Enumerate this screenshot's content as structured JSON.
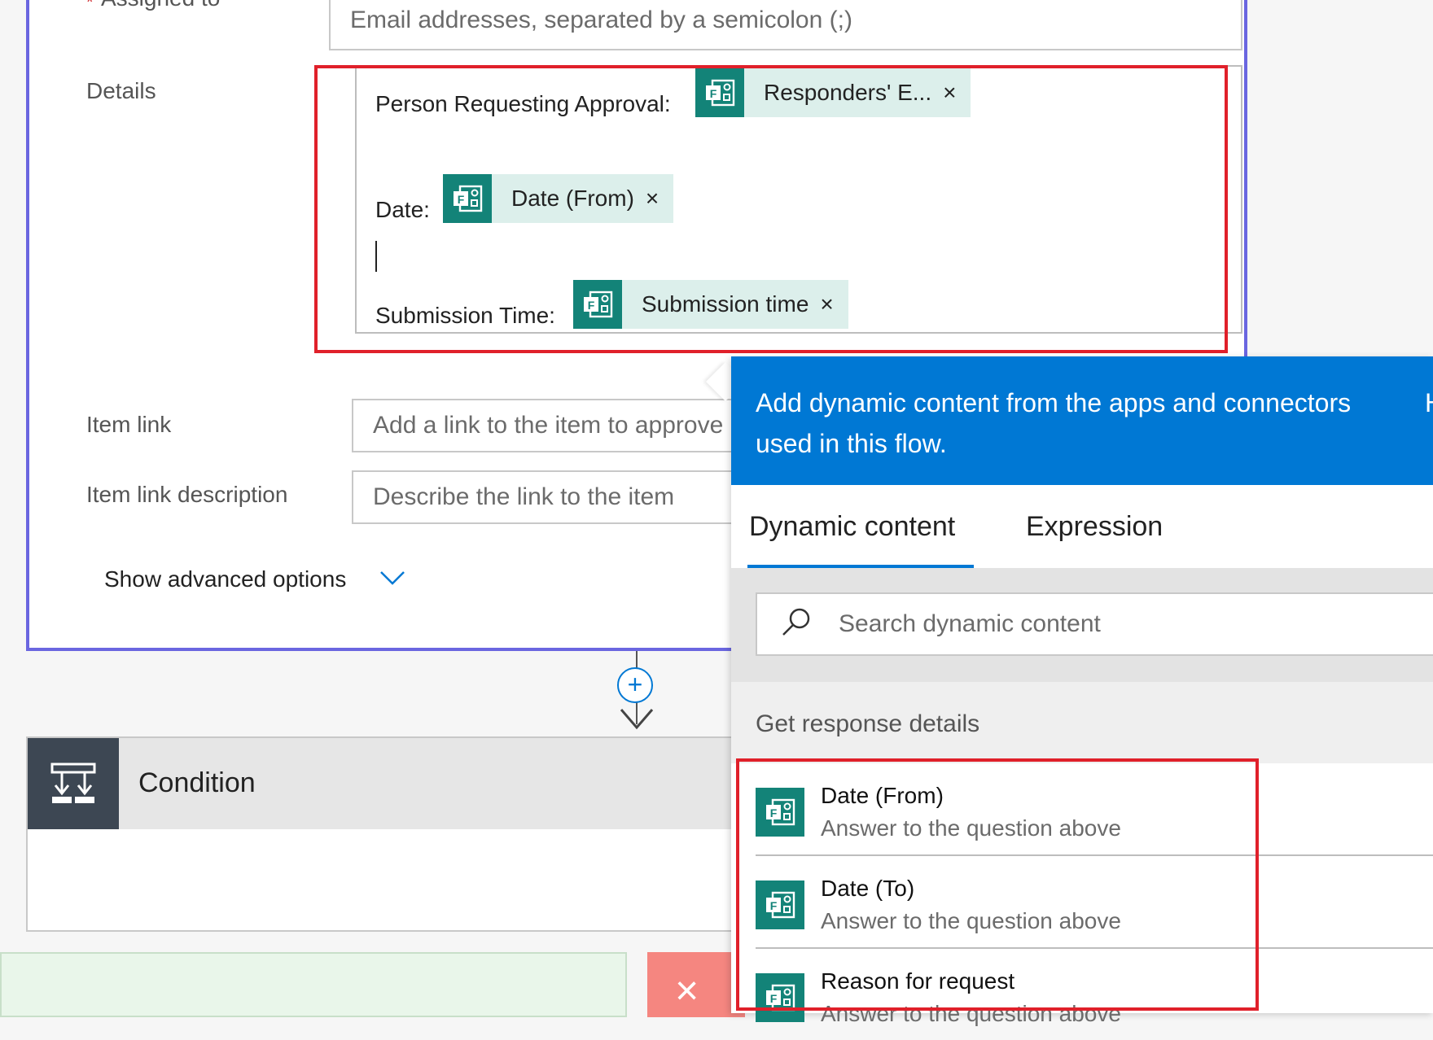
{
  "form": {
    "assigned_to": {
      "star": "*",
      "label": "Assigned to",
      "placeholder": "Email addresses, separated by a semicolon (;)"
    },
    "details": {
      "label": "Details",
      "lines": [
        {
          "label": "Person Requesting Approval:",
          "token": "Responders' E...",
          "remove": "×"
        },
        {
          "label": "Date:",
          "token": "Date (From)",
          "remove": "×"
        },
        {
          "label": "Submission Time:",
          "token": "Submission time",
          "remove": "×"
        }
      ]
    },
    "item_link": {
      "label": "Item link",
      "placeholder": "Add a link to the item to approve"
    },
    "item_link_description": {
      "label": "Item link description",
      "placeholder": "Describe the link to the item"
    },
    "advanced": "Show advanced options"
  },
  "add_step": "+",
  "condition": {
    "title": "Condition"
  },
  "red_panel": {
    "icon_text": "×"
  },
  "dynamic_panel": {
    "header": "Add dynamic content from the apps and connectors used in this flow.",
    "header_extra": "H",
    "tabs": [
      "Dynamic content",
      "Expression"
    ],
    "active_tab": "Dynamic content",
    "search_placeholder": "Search dynamic content",
    "section": "Get response details",
    "items": [
      {
        "title": "Date (From)",
        "subtitle": "Answer to the question above"
      },
      {
        "title": "Date (To)",
        "subtitle": "Answer to the question above"
      },
      {
        "title": "Reason for request",
        "subtitle": "Answer to the question above"
      }
    ]
  },
  "icons": {
    "forms": "forms-icon",
    "condition": "condition-icon",
    "search": "search-icon",
    "chevron": "chevron-down-icon",
    "plus": "plus-icon",
    "close": "close-icon"
  },
  "colors": {
    "accent_blue": "#0078d4",
    "forms_teal": "#138378",
    "token_bg": "#dcefeb",
    "highlight_red": "#e0202a",
    "card_border": "#6a66e0",
    "condition_icon_bg": "#3d4753"
  }
}
